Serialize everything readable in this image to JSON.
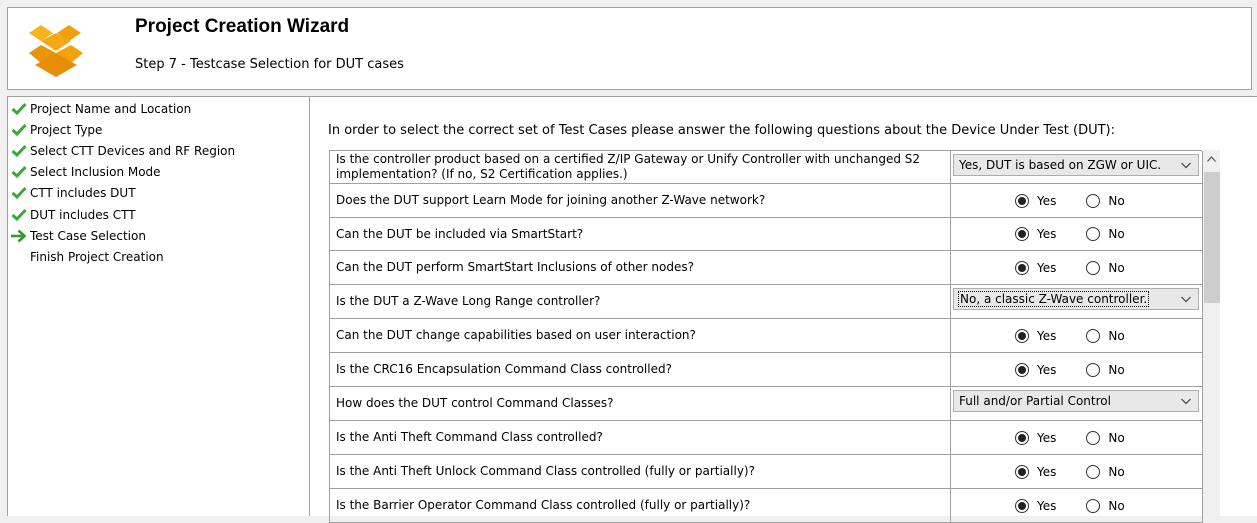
{
  "header": {
    "title": "Project Creation Wizard",
    "subtitle": "Step 7 - Testcase Selection for DUT cases",
    "logo_icon": "stacked-boxes-icon"
  },
  "nav": {
    "items": [
      {
        "label": "Project Name and Location",
        "state": "done",
        "icon": "check-icon"
      },
      {
        "label": "Project Type",
        "state": "done",
        "icon": "check-icon"
      },
      {
        "label": "Select CTT Devices and RF Region",
        "state": "done",
        "icon": "check-icon"
      },
      {
        "label": "Select Inclusion Mode",
        "state": "done",
        "icon": "check-icon"
      },
      {
        "label": "CTT includes DUT",
        "state": "done",
        "icon": "check-icon"
      },
      {
        "label": "DUT includes CTT",
        "state": "done",
        "icon": "check-icon"
      },
      {
        "label": "Test Case Selection",
        "state": "current",
        "icon": "arrow-right-icon"
      },
      {
        "label": "Finish Project Creation",
        "state": "pending",
        "icon": ""
      }
    ]
  },
  "main": {
    "intro": "In order to select the correct set of Test Cases please answer the following questions about the Device Under Test (DUT):",
    "yes_label": "Yes",
    "no_label": "No",
    "questions": [
      {
        "text": "Is the controller product based on a certified Z/IP Gateway or Unify Controller with unchanged S2 implementation? (If no, S2 Certification applies.)",
        "type": "select",
        "value": "Yes, DUT is based on ZGW or UIC."
      },
      {
        "text": "Does the DUT support Learn Mode for joining another Z-Wave network?",
        "type": "radio",
        "value": "Yes"
      },
      {
        "text": "Can the DUT be included via SmartStart?",
        "type": "radio",
        "value": "Yes"
      },
      {
        "text": "Can the DUT perform SmartStart Inclusions of other nodes?",
        "type": "radio",
        "value": "Yes"
      },
      {
        "text": "Is the DUT a Z-Wave Long Range controller?",
        "type": "select",
        "value": "No, a classic Z-Wave controller.",
        "focused": true
      },
      {
        "text": "Can the DUT change capabilities based on user interaction?",
        "type": "radio",
        "value": "Yes"
      },
      {
        "text": "Is the CRC16 Encapsulation Command Class controlled?",
        "type": "radio",
        "value": "Yes"
      },
      {
        "text": "How does the DUT control Command Classes?",
        "type": "select",
        "value": "Full and/or Partial Control"
      },
      {
        "text": "Is the Anti Theft Command Class controlled?",
        "type": "radio",
        "value": "Yes"
      },
      {
        "text": "Is the Anti Theft Unlock Command Class controlled (fully or partially)?",
        "type": "radio",
        "value": "Yes"
      },
      {
        "text": "Is the Barrier Operator Command Class controlled (fully or partially)?",
        "type": "radio",
        "value": "Yes"
      }
    ]
  },
  "colors": {
    "check": "#3aa935",
    "arrow": "#2f9e2a",
    "logo_orange": "#f2a20a",
    "border": "#a0a0a0"
  }
}
